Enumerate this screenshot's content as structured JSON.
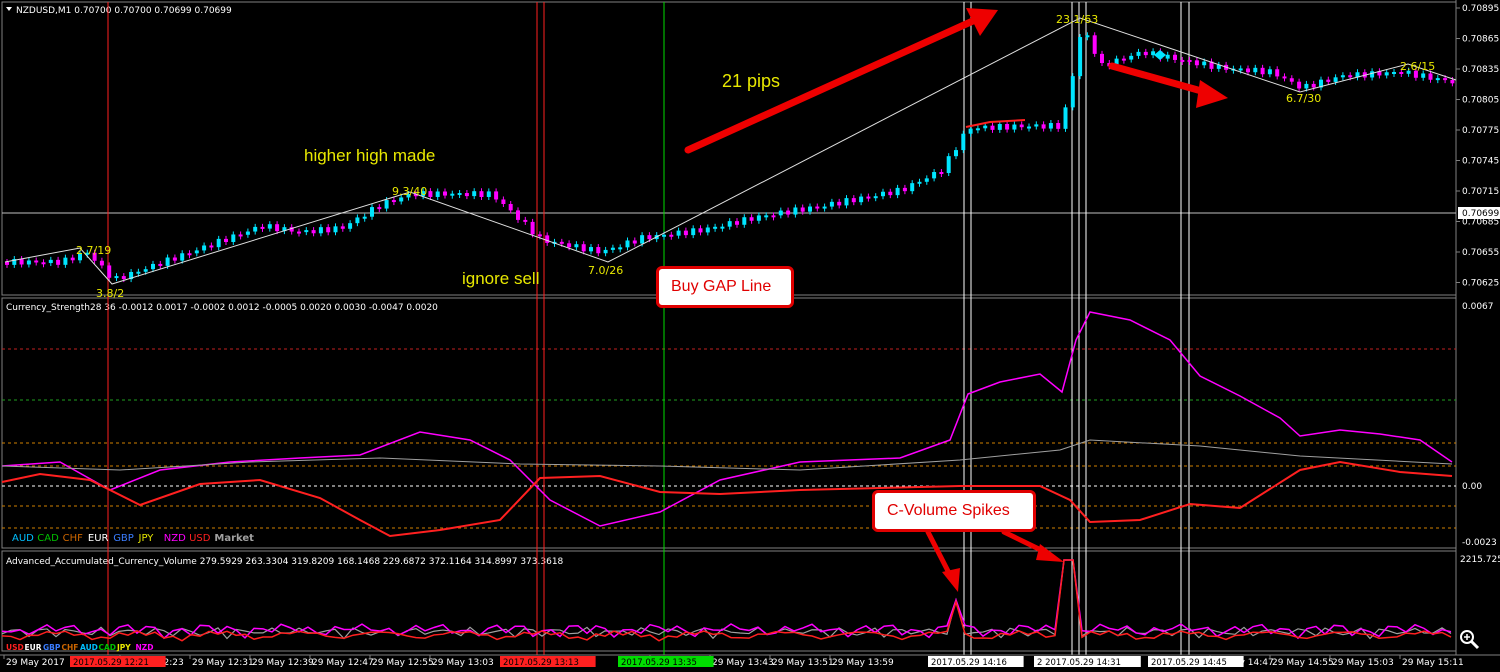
{
  "main_panel": {
    "header": "NZDUSD,M1  0.70700 0.70700 0.70699 0.70699",
    "price_ticks": [
      "0.70895",
      "0.70865",
      "0.70835",
      "0.70805",
      "0.70775",
      "0.70745",
      "0.70715",
      "0.70685",
      "0.70655",
      "0.70625"
    ],
    "current_price": "0.70699",
    "zigzag_labels": [
      "2.7/19",
      "3.8/2",
      "9.3/40",
      "7.0/26",
      "23.1/63",
      "6.7/30",
      "2.6/15"
    ]
  },
  "annotations": {
    "higher_high": "higher high made",
    "ignore_sell": "ignore sell",
    "pips": "21 pips",
    "buy_gap": "Buy GAP Line",
    "c_volume": "C-Volume Spikes"
  },
  "strength_panel": {
    "header": "Currency_Strength28 36 -0.0012 0.0017 -0.0002 0.0012 -0.0005 0.0020 0.0030 -0.0047 0.0020",
    "ticks": [
      "0.0067",
      "0.00",
      "-0.0023"
    ],
    "legend": [
      {
        "label": "AUD",
        "color": "#00bfff"
      },
      {
        "label": "CAD",
        "color": "#00c000"
      },
      {
        "label": "CHF",
        "color": "#cc6600"
      },
      {
        "label": "EUR",
        "color": "#ffffff"
      },
      {
        "label": "GBP",
        "color": "#3a7dff"
      },
      {
        "label": "JPY",
        "color": "#e8e800"
      },
      {
        "label": "NZD",
        "color": "#ff00ff"
      },
      {
        "label": "USD",
        "color": "#ff2020"
      },
      {
        "label": "Market",
        "color": "#a0a0a0"
      }
    ]
  },
  "volume_panel": {
    "header": "Advanced_Accumulated_Currency_Volume  279.5929 263.3304 319.8209 168.1468 229.6872 372.1164 314.8997 373.3618",
    "top_value": "2215.725",
    "legend": [
      {
        "label": "USD",
        "color": "#ff2020"
      },
      {
        "label": "EUR",
        "color": "#ffffff"
      },
      {
        "label": "GBP",
        "color": "#3a7dff"
      },
      {
        "label": "CHF",
        "color": "#cc6600"
      },
      {
        "label": "AUD",
        "color": "#00bfff"
      },
      {
        "label": "CAD",
        "color": "#00c000"
      },
      {
        "label": "JPY",
        "color": "#e8e800"
      },
      {
        "label": "NZD",
        "color": "#ff00ff"
      }
    ]
  },
  "time_axis": [
    "29 May 2017",
    "29 May 12:23",
    "29 May 12:31",
    "29 May 12:39",
    "29 May 12:47",
    "29 May 12:55",
    "29 May 13:03",
    "29 May 13:35",
    "29 May 13:43",
    "29 May 13:51",
    "29 May 13:59",
    "29 May 14:47",
    "29 May 14:55",
    "29 May 15:03",
    "29 May 15:11"
  ],
  "time_highlights": [
    {
      "label": "2017.05.29 12:21",
      "bg": "#ff2020"
    },
    {
      "label": "2017.05.29 13:13",
      "bg": "#ff2020"
    },
    {
      "label": "2017.05.29 13:35",
      "bg": "#00dd00"
    },
    {
      "label": "2017.05.29 14:16",
      "bg": "#ffffff"
    },
    {
      "label": "2 2017.05.29 14:31",
      "bg": "#ffffff"
    },
    {
      "label": "2017.05.29 14:45",
      "bg": "#ffffff"
    }
  ]
}
